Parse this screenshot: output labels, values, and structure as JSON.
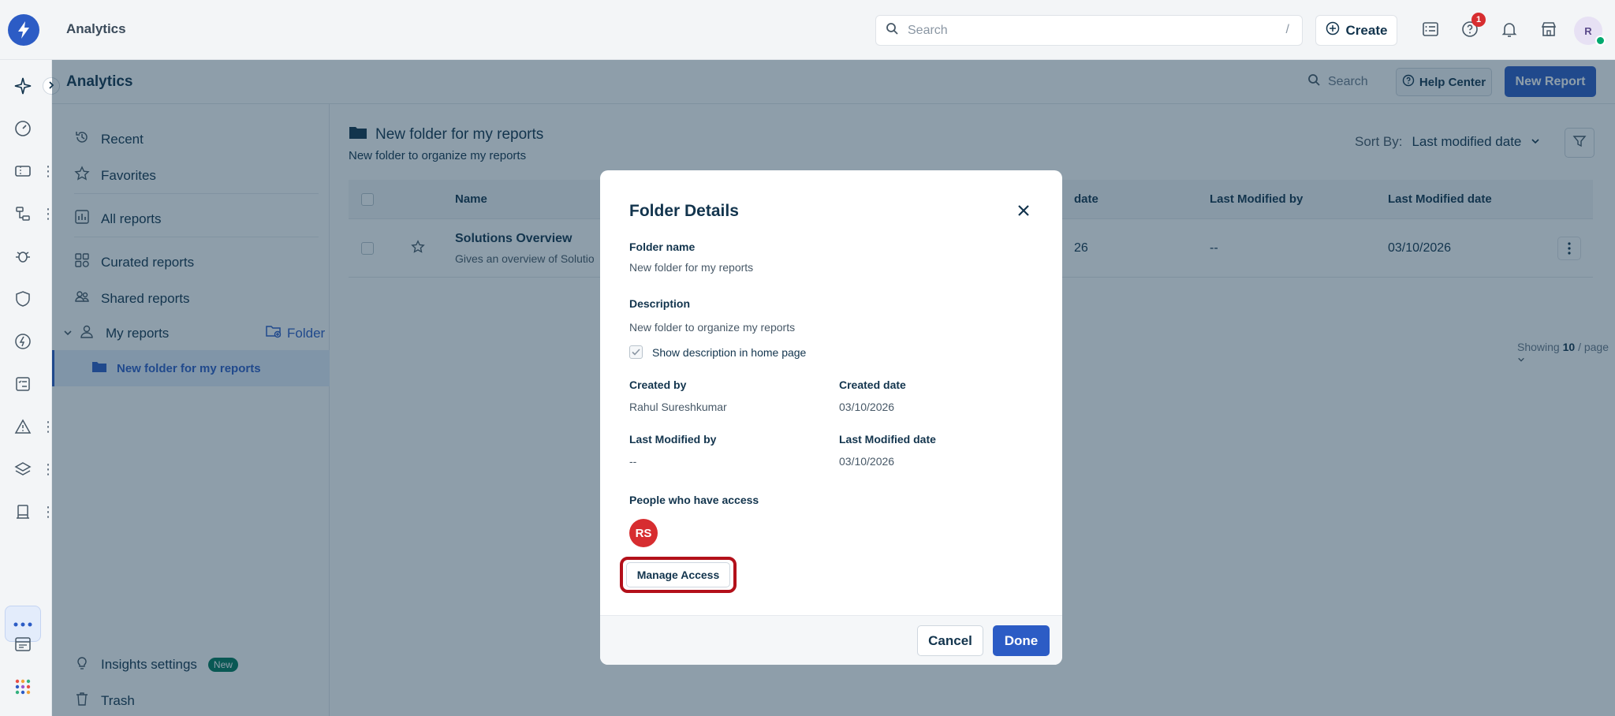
{
  "topbar": {
    "app_title": "Analytics",
    "search_placeholder": "Search",
    "search_shortcut": "/",
    "create_label": "Create",
    "help_badge_count": "1",
    "avatar_initial": "R"
  },
  "main_header": {
    "title": "Analytics",
    "search_label": "Search",
    "help_center_label": "Help Center",
    "new_report_label": "New Report"
  },
  "sidebar": {
    "items": [
      {
        "label": "Recent",
        "icon": "history-icon"
      },
      {
        "label": "Favorites",
        "icon": "star-icon"
      },
      {
        "label": "All reports",
        "icon": "chart-icon"
      },
      {
        "label": "Curated reports",
        "icon": "grid-icon"
      },
      {
        "label": "Shared reports",
        "icon": "people-icon"
      },
      {
        "label": "My reports",
        "icon": "person-icon"
      },
      {
        "label": "New folder for my reports",
        "icon": "folder-icon"
      }
    ],
    "folder_action_label": "Folder",
    "insights_settings_label": "Insights settings",
    "insights_badge": "New",
    "trash_label": "Trash"
  },
  "content": {
    "folder_title": "New folder for my reports",
    "folder_description": "New folder to organize my reports",
    "sort_label": "Sort By:",
    "sort_value": "Last modified date",
    "table": {
      "columns": [
        "Name",
        "date",
        "Last Modified by",
        "Last Modified date"
      ],
      "rows": [
        {
          "name": "Solutions Overview",
          "subtitle": "Gives an overview of Solutio",
          "created_date_partial": "26",
          "last_modified_by": "--",
          "last_modified_date": "03/10/2026"
        }
      ]
    },
    "showing_prefix": "Showing",
    "showing_count": "10",
    "showing_suffix": "/ page"
  },
  "modal": {
    "title": "Folder Details",
    "folder_name_label": "Folder name",
    "folder_name_value": "New folder for my reports",
    "description_label": "Description",
    "description_value": "New folder to organize my reports",
    "show_description_label": "Show description in home page",
    "show_description_checked": true,
    "created_by_label": "Created by",
    "created_by_value": "Rahul Sureshkumar",
    "created_date_label": "Created date",
    "created_date_value": "03/10/2026",
    "last_modified_by_label": "Last Modified by",
    "last_modified_by_value": "--",
    "last_modified_date_label": "Last Modified date",
    "last_modified_date_value": "03/10/2026",
    "people_access_label": "People who have access",
    "access_avatar_initials": "RS",
    "manage_access_label": "Manage Access",
    "cancel_label": "Cancel",
    "done_label": "Done"
  },
  "colors": {
    "primary": "#2c5cc5",
    "highlight_ring": "#b3101a",
    "avatar_red": "#d72d30",
    "new_badge": "#00795b"
  }
}
